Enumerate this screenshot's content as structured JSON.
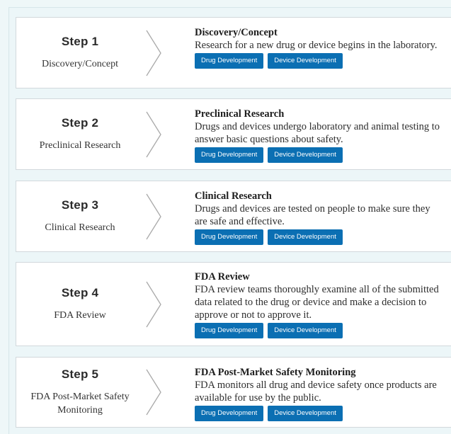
{
  "steps": [
    {
      "number": "Step 1",
      "subtitle": "Discovery/Concept",
      "title": "Discovery/Concept",
      "description": "Research for a new drug or device begins in the laboratory.",
      "buttons": [
        "Drug Development",
        "Device Development"
      ]
    },
    {
      "number": "Step 2",
      "subtitle": "Preclinical Research",
      "title": "Preclinical Research",
      "description": "Drugs and devices undergo laboratory and animal testing to answer basic questions about safety.",
      "buttons": [
        "Drug Development",
        "Device Development"
      ]
    },
    {
      "number": "Step 3",
      "subtitle": "Clinical Research",
      "title": "Clinical Research",
      "description": "Drugs and devices are tested on people to make sure they are safe and effective.",
      "buttons": [
        "Drug Development",
        "Device Development"
      ]
    },
    {
      "number": "Step 4",
      "subtitle": "FDA Review",
      "title": "FDA Review",
      "description": "FDA review teams thoroughly examine all of the submitted data related to the drug or device and make a decision to approve or not to approve it.",
      "buttons": [
        "Drug Development",
        "Device Development"
      ]
    },
    {
      "number": "Step 5",
      "subtitle": "FDA Post-Market Safety Monitoring",
      "title": "FDA Post-Market Safety Monitoring",
      "description": "FDA monitors all drug and device safety once products are available for use by the public.",
      "buttons": [
        "Drug Development",
        "Device Development"
      ]
    }
  ],
  "colors": {
    "button_bg": "#0b6fb3",
    "button_text": "#ffffff",
    "page_bg": "#ecf6f8",
    "card_bg": "#ffffff"
  },
  "icons": {
    "separator": "chevron-right-icon"
  }
}
